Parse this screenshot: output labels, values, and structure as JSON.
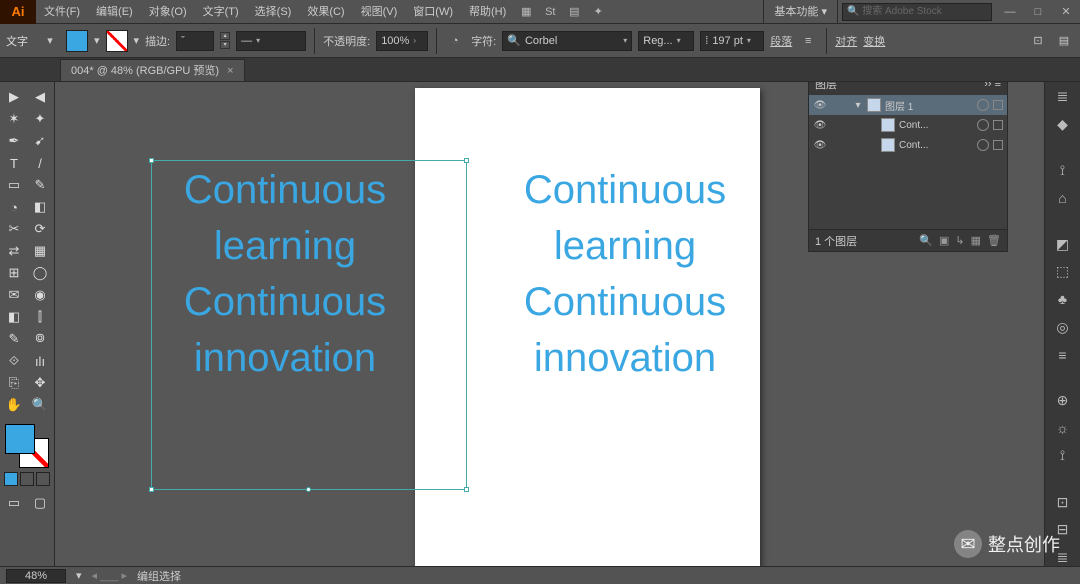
{
  "app": {
    "logo": "Ai"
  },
  "menus": [
    "文件(F)",
    "编辑(E)",
    "对象(O)",
    "文字(T)",
    "选择(S)",
    "效果(C)",
    "视图(V)",
    "窗口(W)",
    "帮助(H)"
  ],
  "workspace": {
    "label": "基本功能",
    "search_placeholder": "搜索 Adobe Stock"
  },
  "window_controls": {
    "min": "—",
    "max": "□",
    "close": "✕"
  },
  "ctrl": {
    "mode": "文字",
    "stroke_label": "描边:",
    "stroke_menu": "ˇ",
    "opacity_label": "不透明度:",
    "opacity_value": "100%",
    "char_label": "字符:",
    "font": "Corbel",
    "style": "Reg...",
    "size": "197 pt",
    "para": "段落",
    "align": "对齐",
    "transform": "变换"
  },
  "tab": {
    "title": "004* @ 48% (RGB/GPU 预览)",
    "close": "×"
  },
  "canvas_text": "Continuous learning Continuous innovation",
  "layers": {
    "title": "图层",
    "rows": [
      {
        "name": "图层 1",
        "indent": 0,
        "sel": true,
        "expand": "▾"
      },
      {
        "name": "Cont...",
        "indent": 1,
        "sel": false,
        "expand": ""
      },
      {
        "name": "Cont...",
        "indent": 1,
        "sel": false,
        "expand": ""
      }
    ],
    "footer": "1 个图层"
  },
  "status": {
    "zoom": "48%",
    "tool": "编组选择"
  },
  "tools_grid": [
    [
      "▶",
      "◀"
    ],
    [
      "✶",
      "✦"
    ],
    [
      "✒",
      "➹"
    ],
    [
      "T",
      "/"
    ],
    [
      "▭",
      "✎"
    ],
    [
      "◔",
      "◧"
    ],
    [
      "✂",
      "⟳"
    ],
    [
      "⇄",
      "▦"
    ],
    [
      "⊞",
      "◯"
    ],
    [
      "✉",
      "◉"
    ],
    [
      "◧",
      "⫿"
    ],
    [
      "✎",
      "៙"
    ],
    [
      "⟐",
      "ılı"
    ],
    [
      "⎘",
      "✥"
    ],
    [
      "✋",
      "🔍"
    ]
  ],
  "mini_modes": [
    "■",
    "▦",
    "▭"
  ],
  "screen_modes": [
    "▭",
    "▢"
  ],
  "right_icons": [
    "≣",
    "◆",
    "⟟",
    "⌂",
    "◩",
    "⬚",
    "♣",
    "◎",
    "≡",
    "⊕",
    "☼",
    "⟟",
    "⊡",
    "⊟",
    "≣"
  ],
  "watermark": "整点创作"
}
